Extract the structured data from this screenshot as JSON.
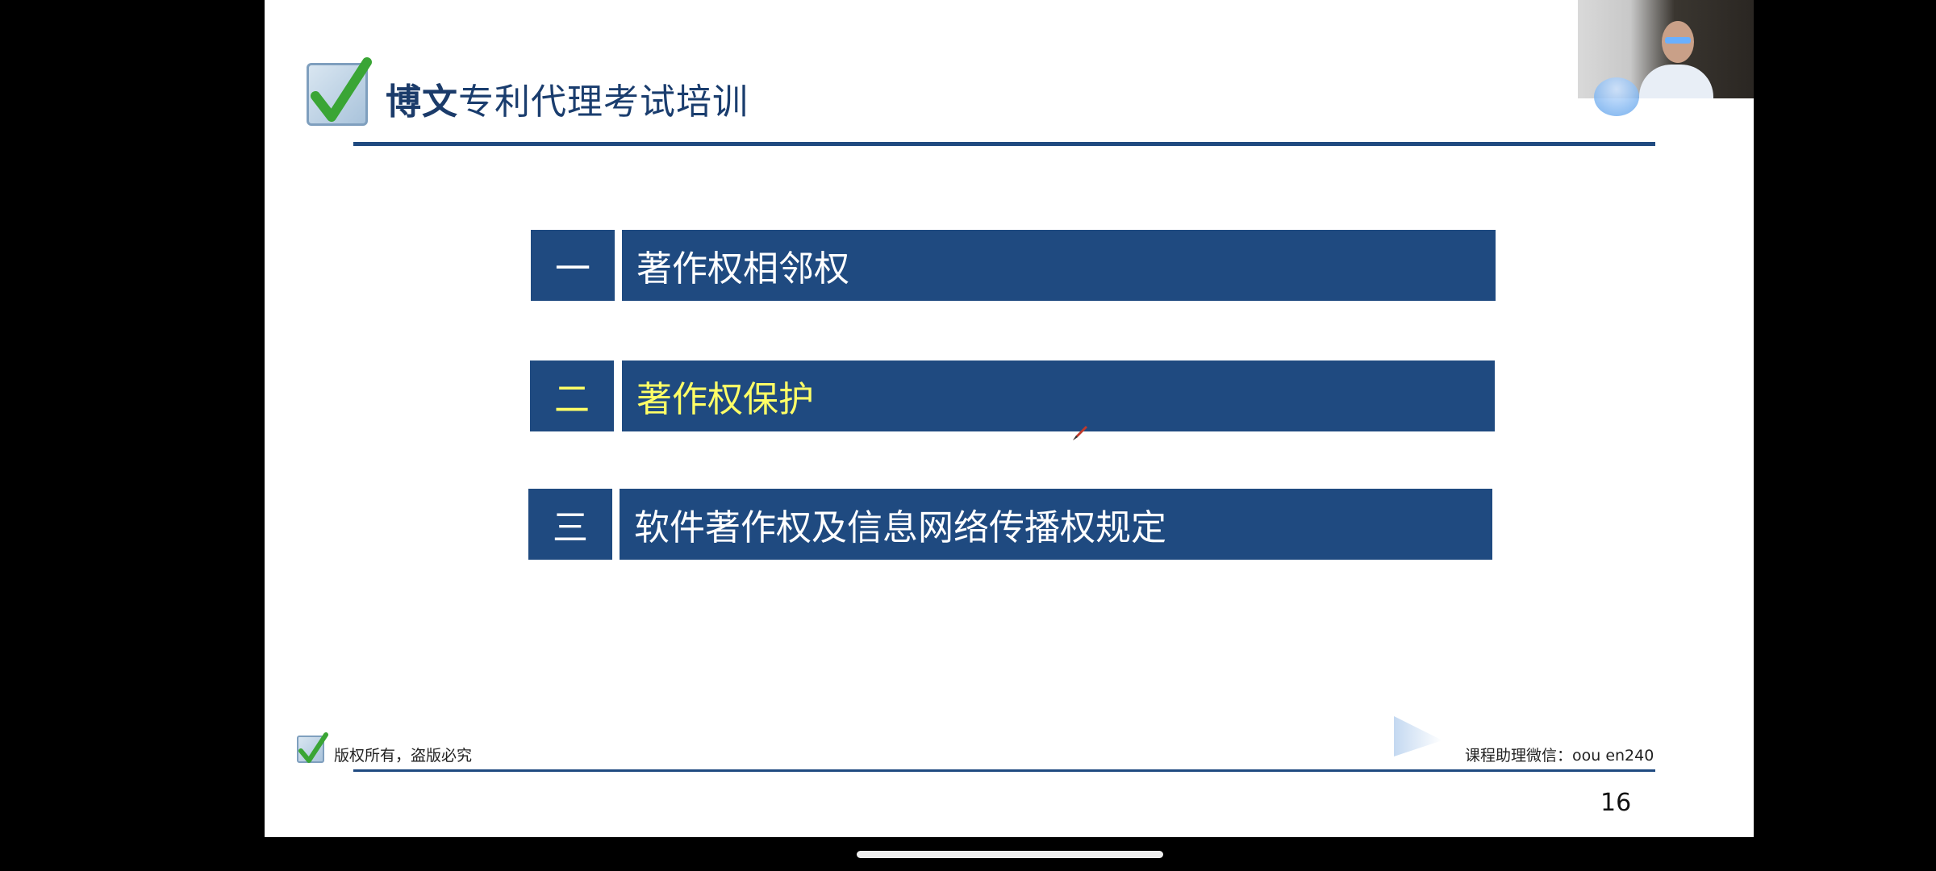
{
  "header": {
    "brand": "博文",
    "rest": "专利代理考试培训"
  },
  "items": [
    {
      "num": "一",
      "label": "著作权相邻权",
      "highlighted": false
    },
    {
      "num": "二",
      "label": "著作权保护",
      "highlighted": true
    },
    {
      "num": "三",
      "label": "软件著作权及信息网络传播权规定",
      "highlighted": false
    }
  ],
  "footer": {
    "copyright": "版权所有，盗版必究",
    "contact": "课程助理微信：oou en240",
    "page_number": "16"
  },
  "colors": {
    "bar": "#1f4a80",
    "highlight_text": "#ffff66"
  }
}
